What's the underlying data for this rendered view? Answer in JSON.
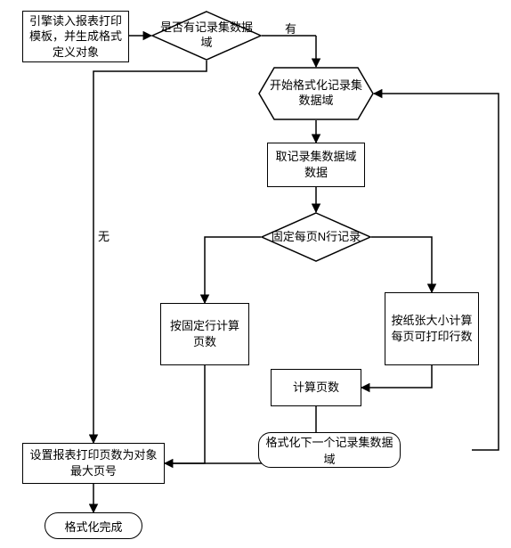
{
  "nodes": {
    "n1": "引擎读入报表打印模板，并生成格式定义对象",
    "d1": "是否有记录集数据域",
    "hx": "开始格式化记录集数据域",
    "n2": "取记录集数据域数据",
    "d2": "固定每页N行记录",
    "n3": "按固定行计算页数",
    "n4": "按纸张大小计算每页可打印行数",
    "n5": "计算页数",
    "n6": "设置报表打印页数为对象最大页号",
    "alt": "格式化下一个记录集数据域",
    "end": "格式化完成"
  },
  "labels": {
    "yes": "有",
    "no": "无"
  },
  "chart_data": {
    "type": "table",
    "title": "报表打印格式化流程",
    "nodes": [
      {
        "id": "n1",
        "type": "process",
        "text": "引擎读入报表打印模板，并生成格式定义对象"
      },
      {
        "id": "d1",
        "type": "decision",
        "text": "是否有记录集数据域"
      },
      {
        "id": "hx",
        "type": "preparation",
        "text": "开始格式化记录集数据域"
      },
      {
        "id": "n2",
        "type": "process",
        "text": "取记录集数据域数据"
      },
      {
        "id": "d2",
        "type": "decision",
        "text": "固定每页N行记录"
      },
      {
        "id": "n3",
        "type": "process",
        "text": "按固定行计算页数"
      },
      {
        "id": "n4",
        "type": "process",
        "text": "按纸张大小计算每页可打印行数"
      },
      {
        "id": "n5",
        "type": "process",
        "text": "计算页数"
      },
      {
        "id": "n6",
        "type": "process",
        "text": "设置报表打印页数为对象最大页号"
      },
      {
        "id": "alt",
        "type": "alt-process",
        "text": "格式化下一个记录集数据域"
      },
      {
        "id": "end",
        "type": "terminator",
        "text": "格式化完成"
      }
    ],
    "edges": [
      {
        "from": "n1",
        "to": "d1"
      },
      {
        "from": "d1",
        "to": "hx",
        "label": "有"
      },
      {
        "from": "d1",
        "to": "n6",
        "label": "无"
      },
      {
        "from": "hx",
        "to": "n2"
      },
      {
        "from": "n2",
        "to": "d2"
      },
      {
        "from": "d2",
        "to": "n3"
      },
      {
        "from": "d2",
        "to": "n4"
      },
      {
        "from": "n3",
        "to": "n6"
      },
      {
        "from": "n4",
        "to": "n5"
      },
      {
        "from": "n5",
        "to": "n6"
      },
      {
        "from": "n6",
        "to": "alt"
      },
      {
        "from": "alt",
        "to": "hx"
      },
      {
        "from": "n6",
        "to": "end"
      }
    ]
  }
}
